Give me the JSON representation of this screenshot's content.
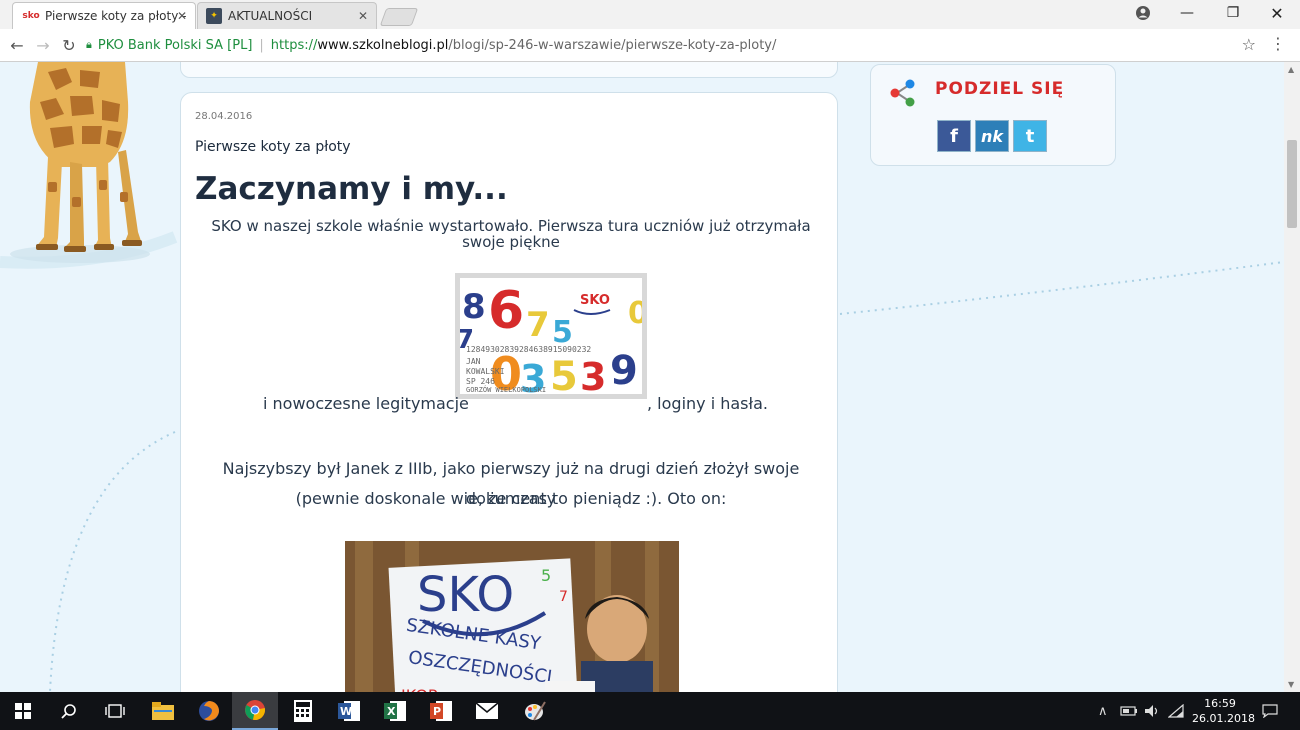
{
  "browser": {
    "tabs": [
      {
        "title": "Pierwsze koty za płoty - ",
        "favicon": "sko-icon",
        "active": true
      },
      {
        "title": "AKTUALNOŚCI",
        "favicon": "skladak-icon",
        "active": false
      }
    ],
    "address": {
      "security_label": "PKO Bank Polski SA [PL]",
      "url_protocol": "https://",
      "url_host": "www.szkolneblogi.pl",
      "url_path": "/blogi/sp-246-w-warszawie/pierwsze-koty-za-ploty/"
    }
  },
  "post": {
    "date": "28.04.2016",
    "title": "Pierwsze koty za płoty",
    "heading": "Zaczynamy i my...",
    "intro_line1": "SKO w naszej szkole właśnie wystartowało. Pierwsza tura uczniów już otrzymała",
    "intro_line2": "swoje piękne",
    "card_prefix": "i nowoczesne legitymacje",
    "card_suffix": ", loginy i hasła.",
    "para2_line1": "Najszybszy był Janek z IIIb, jako pierwszy już na drugi dzień złożył swoje dokumenty",
    "para2_line2": "(pewnie doskonale wie, że czas to pieniądz :). Oto on:"
  },
  "share": {
    "title": "PODZIEL SIĘ",
    "buttons": [
      {
        "label": "f",
        "name": "facebook"
      },
      {
        "label": "nk",
        "name": "nk"
      },
      {
        "label": "t",
        "name": "twitter"
      }
    ]
  },
  "taskbar": {
    "time": "16:59",
    "date": "26.01.2018"
  },
  "colors": {
    "page_bg": "#eaf5fc",
    "facebook": "#3b5998",
    "nk": "#2d7fb8",
    "twitter": "#3fb4e6",
    "security_green": "#1e8e3e"
  }
}
